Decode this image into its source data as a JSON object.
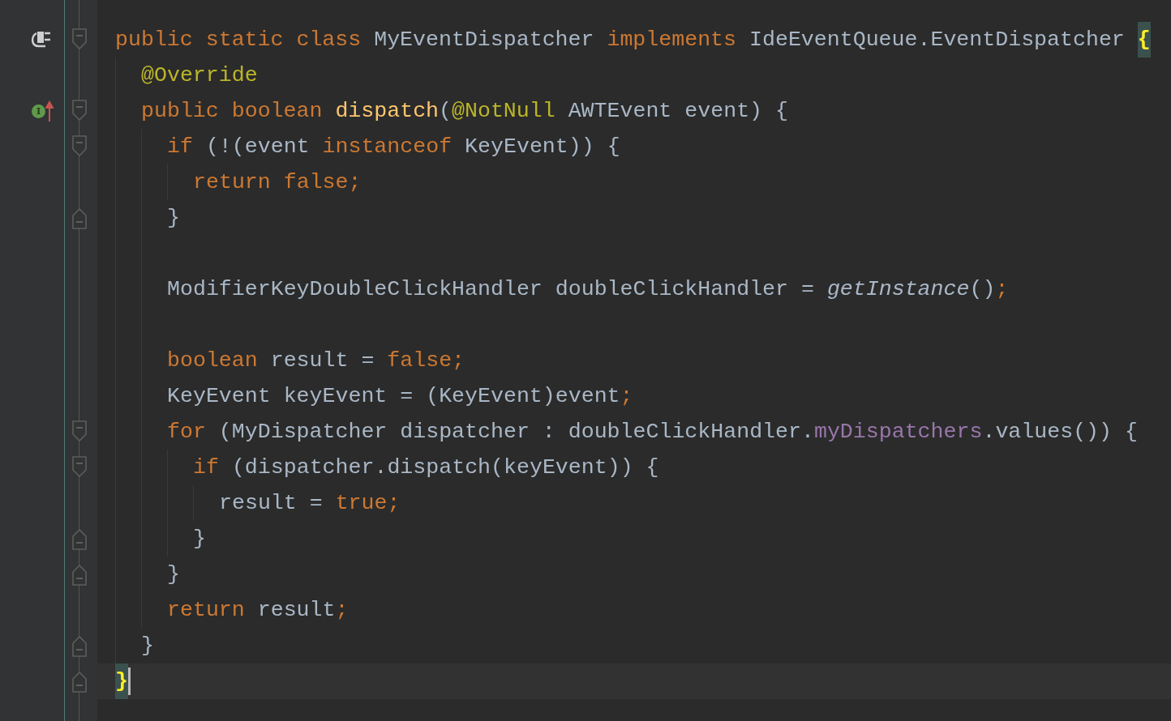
{
  "editor": {
    "lines": [
      {
        "gutter_icon": {
          "kind": "plug"
        },
        "fold_marker": {
          "kind": "start"
        },
        "current": false,
        "tokens": [
          {
            "kind": "keyword",
            "text": "public static class "
          },
          {
            "kind": "plain",
            "text": "MyEventDispatcher "
          },
          {
            "kind": "keyword",
            "text": "implements "
          },
          {
            "kind": "plain",
            "text": "IdeEventQueue.EventDispatcher "
          },
          {
            "kind": "brace_match",
            "text": "{"
          }
        ],
        "children": [
          {
            "current": false,
            "tokens": [
              {
                "kind": "annotation",
                "text": "@Override"
              }
            ]
          },
          {
            "gutter_icon": {
              "kind": "implements",
              "label": "I"
            },
            "fold_marker": {
              "kind": "start"
            },
            "current": false,
            "tokens": [
              {
                "kind": "keyword",
                "text": "public boolean "
              },
              {
                "kind": "method",
                "text": "dispatch"
              },
              {
                "kind": "plain",
                "text": "("
              },
              {
                "kind": "annotation",
                "text": "@NotNull"
              },
              {
                "kind": "plain",
                "text": " AWTEvent event) {"
              }
            ],
            "children": [
              {
                "fold_marker": {
                  "kind": "start"
                },
                "current": false,
                "tokens": [
                  {
                    "kind": "keyword",
                    "text": "if "
                  },
                  {
                    "kind": "plain",
                    "text": "(!(event "
                  },
                  {
                    "kind": "keyword",
                    "text": "instanceof "
                  },
                  {
                    "kind": "plain",
                    "text": "KeyEvent)) {"
                  }
                ],
                "children": [
                  {
                    "current": false,
                    "tokens": [
                      {
                        "kind": "keyword",
                        "text": "return false;"
                      }
                    ]
                  }
                ]
              },
              {
                "fold_marker": {
                  "kind": "end"
                },
                "current": false,
                "tokens": [
                  {
                    "kind": "plain",
                    "text": "}"
                  }
                ]
              },
              {
                "current": false
              },
              {
                "current": false,
                "tokens": [
                  {
                    "kind": "plain",
                    "text": "ModifierKeyDoubleClickHandler doubleClickHandler = "
                  },
                  {
                    "kind": "static_call",
                    "text": "getInstance"
                  },
                  {
                    "kind": "plain",
                    "text": "()"
                  },
                  {
                    "kind": "keyword",
                    "text": ";"
                  }
                ]
              },
              {
                "current": false
              },
              {
                "current": false,
                "tokens": [
                  {
                    "kind": "keyword",
                    "text": "boolean "
                  },
                  {
                    "kind": "plain",
                    "text": "result = "
                  },
                  {
                    "kind": "keyword",
                    "text": "false;"
                  }
                ]
              },
              {
                "current": false,
                "tokens": [
                  {
                    "kind": "plain",
                    "text": "KeyEvent keyEvent = (KeyEvent)event"
                  },
                  {
                    "kind": "keyword",
                    "text": ";"
                  }
                ]
              },
              {
                "fold_marker": {
                  "kind": "start"
                },
                "current": false,
                "tokens": [
                  {
                    "kind": "keyword",
                    "text": "for "
                  },
                  {
                    "kind": "plain",
                    "text": "(MyDispatcher dispatcher : doubleClickHandler."
                  },
                  {
                    "kind": "field",
                    "text": "myDispatchers"
                  },
                  {
                    "kind": "plain",
                    "text": ".values()) {"
                  }
                ],
                "children": [
                  {
                    "fold_marker": {
                      "kind": "start"
                    },
                    "current": false,
                    "tokens": [
                      {
                        "kind": "keyword",
                        "text": "if "
                      },
                      {
                        "kind": "plain",
                        "text": "(dispatcher.dispatch(keyEvent)) {"
                      }
                    ],
                    "children": [
                      {
                        "current": false,
                        "tokens": [
                          {
                            "kind": "plain",
                            "text": "result = "
                          },
                          {
                            "kind": "keyword",
                            "text": "true;"
                          }
                        ]
                      }
                    ]
                  },
                  {
                    "fold_marker": {
                      "kind": "end"
                    },
                    "current": false,
                    "tokens": [
                      {
                        "kind": "plain",
                        "text": "}"
                      }
                    ]
                  }
                ]
              },
              {
                "fold_marker": {
                  "kind": "end"
                },
                "current": false,
                "tokens": [
                  {
                    "kind": "plain",
                    "text": "}"
                  }
                ]
              },
              {
                "current": false,
                "tokens": [
                  {
                    "kind": "keyword",
                    "text": "return "
                  },
                  {
                    "kind": "plain",
                    "text": "result"
                  },
                  {
                    "kind": "keyword",
                    "text": ";"
                  }
                ]
              }
            ]
          },
          {
            "fold_marker": {
              "kind": "end"
            },
            "current": false,
            "tokens": [
              {
                "kind": "plain",
                "text": "}"
              }
            ]
          }
        ]
      },
      {
        "fold_marker": {
          "kind": "end"
        },
        "current": true,
        "tokens": [
          {
            "kind": "brace_match",
            "text": "}"
          }
        ]
      }
    ]
  }
}
